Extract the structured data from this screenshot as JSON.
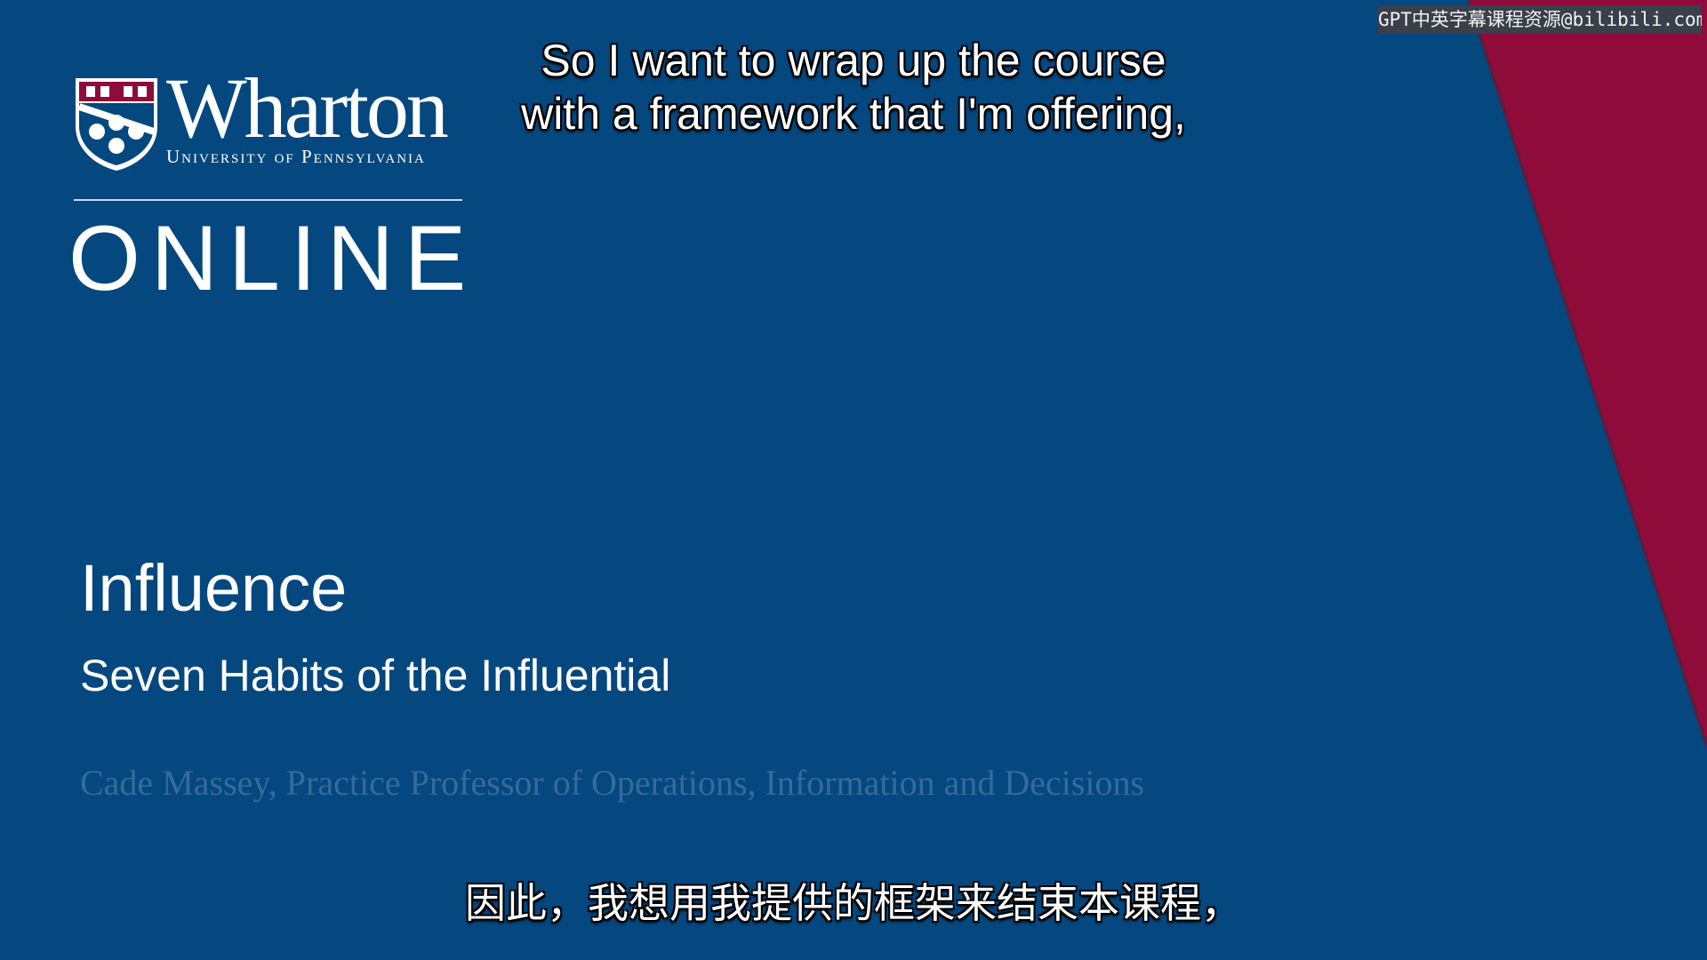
{
  "watermark": {
    "text": "GPT中英字幕课程资源@bilibili.com"
  },
  "logo": {
    "wordmark": "Wharton",
    "university": "University of Pennsylvania",
    "online": "ONLINE",
    "shield_icon": "penn-shield-icon"
  },
  "slide": {
    "title": "Influence",
    "subtitle": "Seven Habits of the Influential",
    "presenter": "Cade Massey, Practice Professor of Operations, Information and Decisions"
  },
  "captions": {
    "english_lines": [
      "So I want to wrap up the course",
      "with a framework that I'm offering,"
    ],
    "chinese": "因此，我想用我提供的框架来结束本课程，"
  },
  "colors": {
    "background": "#05477f",
    "accent_red": "#8f0b3a",
    "text": "#ffffff"
  }
}
